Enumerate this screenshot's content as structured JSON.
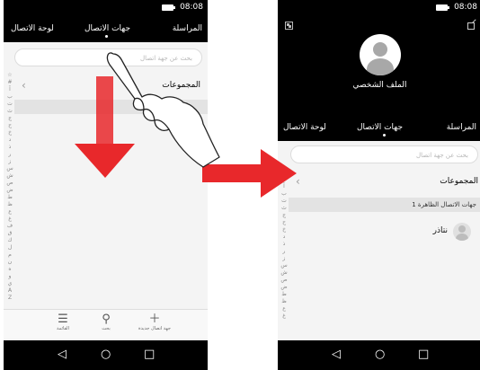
{
  "status": {
    "time": "08:08"
  },
  "left_phone": {
    "tabs": [
      {
        "label": "المراسلة"
      },
      {
        "label": "جهات الاتصال"
      },
      {
        "label": "لوحة الاتصال"
      }
    ],
    "search_placeholder": "بحث عن جهة اتصال",
    "groups_label": "المجموعات",
    "index_letters": [
      "☆",
      "#",
      "آ",
      "ب",
      "ت",
      "ث",
      "ج",
      "ح",
      "خ",
      "د",
      "ذ",
      "ر",
      "ز",
      "س",
      "ش",
      "ص",
      "ض",
      "ط",
      "ظ",
      "ع",
      "غ",
      "ف",
      "ق",
      "ك",
      "ل",
      "م",
      "ن",
      "ه",
      "و",
      "ي",
      "A",
      "Z"
    ],
    "bottom_actions": [
      {
        "icon": "plus-icon",
        "label": "جهة اتصال جديدة"
      },
      {
        "icon": "search-icon",
        "label": "بحث"
      },
      {
        "icon": "menu-icon",
        "label": "القائمة"
      }
    ]
  },
  "right_phone": {
    "profile_label": "الملف الشخصي",
    "tabs": [
      {
        "label": "المراسلة"
      },
      {
        "label": "جهات الاتصال"
      },
      {
        "label": "لوحة الاتصال"
      }
    ],
    "search_placeholder": "بحث عن جهة اتصال",
    "groups_label": "المجموعات",
    "section_header": "جهات الاتصال الظاهرة 1",
    "contact_name": "نتاذر",
    "index_letters": [
      "☆",
      "#",
      "آ",
      "ب",
      "ت",
      "ث",
      "ج",
      "ح",
      "خ",
      "د",
      "ذ",
      "ر",
      "ز",
      "س",
      "ش",
      "ص",
      "ض",
      "ط",
      "ظ",
      "ع",
      "غ"
    ]
  },
  "colors": {
    "arrow_red": "#e8282b",
    "hand_stroke": "#222222"
  }
}
